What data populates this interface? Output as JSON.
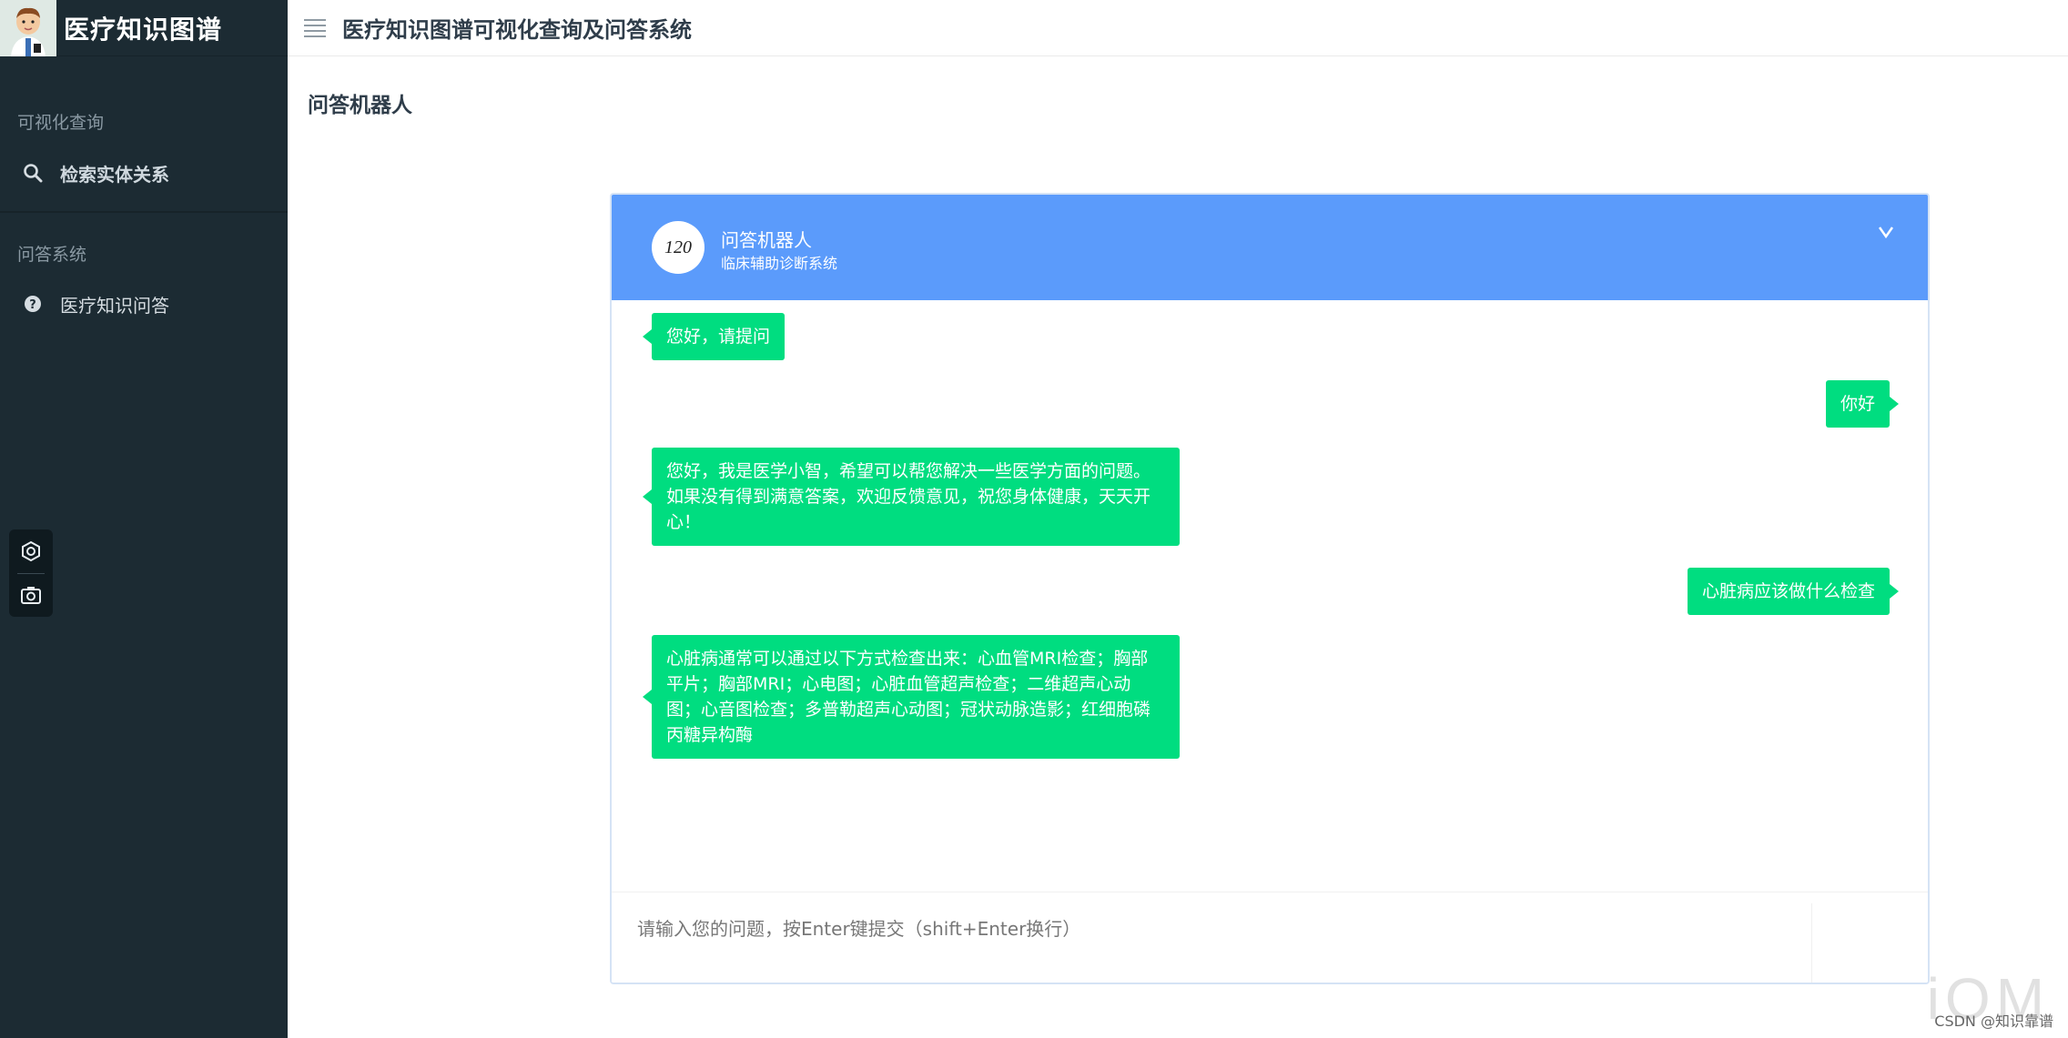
{
  "sidebar": {
    "brand_title": "医疗知识图谱",
    "sections": [
      {
        "label": "可视化查询",
        "items": [
          {
            "label": "检索实体关系",
            "icon": "search-icon"
          }
        ]
      },
      {
        "label": "问答系统",
        "items": [
          {
            "label": "医疗知识问答",
            "icon": "question-circle-icon"
          }
        ]
      }
    ],
    "tools": [
      "settings-icon",
      "camera-icon"
    ]
  },
  "header": {
    "title": "医疗知识图谱可视化查询及问答系统"
  },
  "page": {
    "title": "问答机器人"
  },
  "chat": {
    "avatar_text": "120",
    "bot_name": "问答机器人",
    "bot_subtitle": "临床辅助诊断系统",
    "messages": [
      {
        "side": "left",
        "text": "您好，请提问"
      },
      {
        "side": "right",
        "text": "你好"
      },
      {
        "side": "left",
        "text": "您好，我是医学小智，希望可以帮您解决一些医学方面的问题。如果没有得到满意答案，欢迎反馈意见，祝您身体健康，天天开心！"
      },
      {
        "side": "right",
        "text": "心脏病应该做什么检查"
      },
      {
        "side": "left",
        "text": "心脏病通常可以通过以下方式检查出来：心血管MRI检查；胸部平片；胸部MRI；心电图；心脏血管超声检查；二维超声心动图；心音图检查；多普勒超声心动图；冠状动脉造影；红细胞磷丙糖异构酶"
      }
    ],
    "input_placeholder": "请输入您的问题，按Enter键提交（shift+Enter换行）",
    "bubble_color": "#00dd80",
    "header_color": "#5b9bfb"
  },
  "watermark": {
    "text": "CSDN @知识靠谱",
    "logo": "iOM"
  }
}
